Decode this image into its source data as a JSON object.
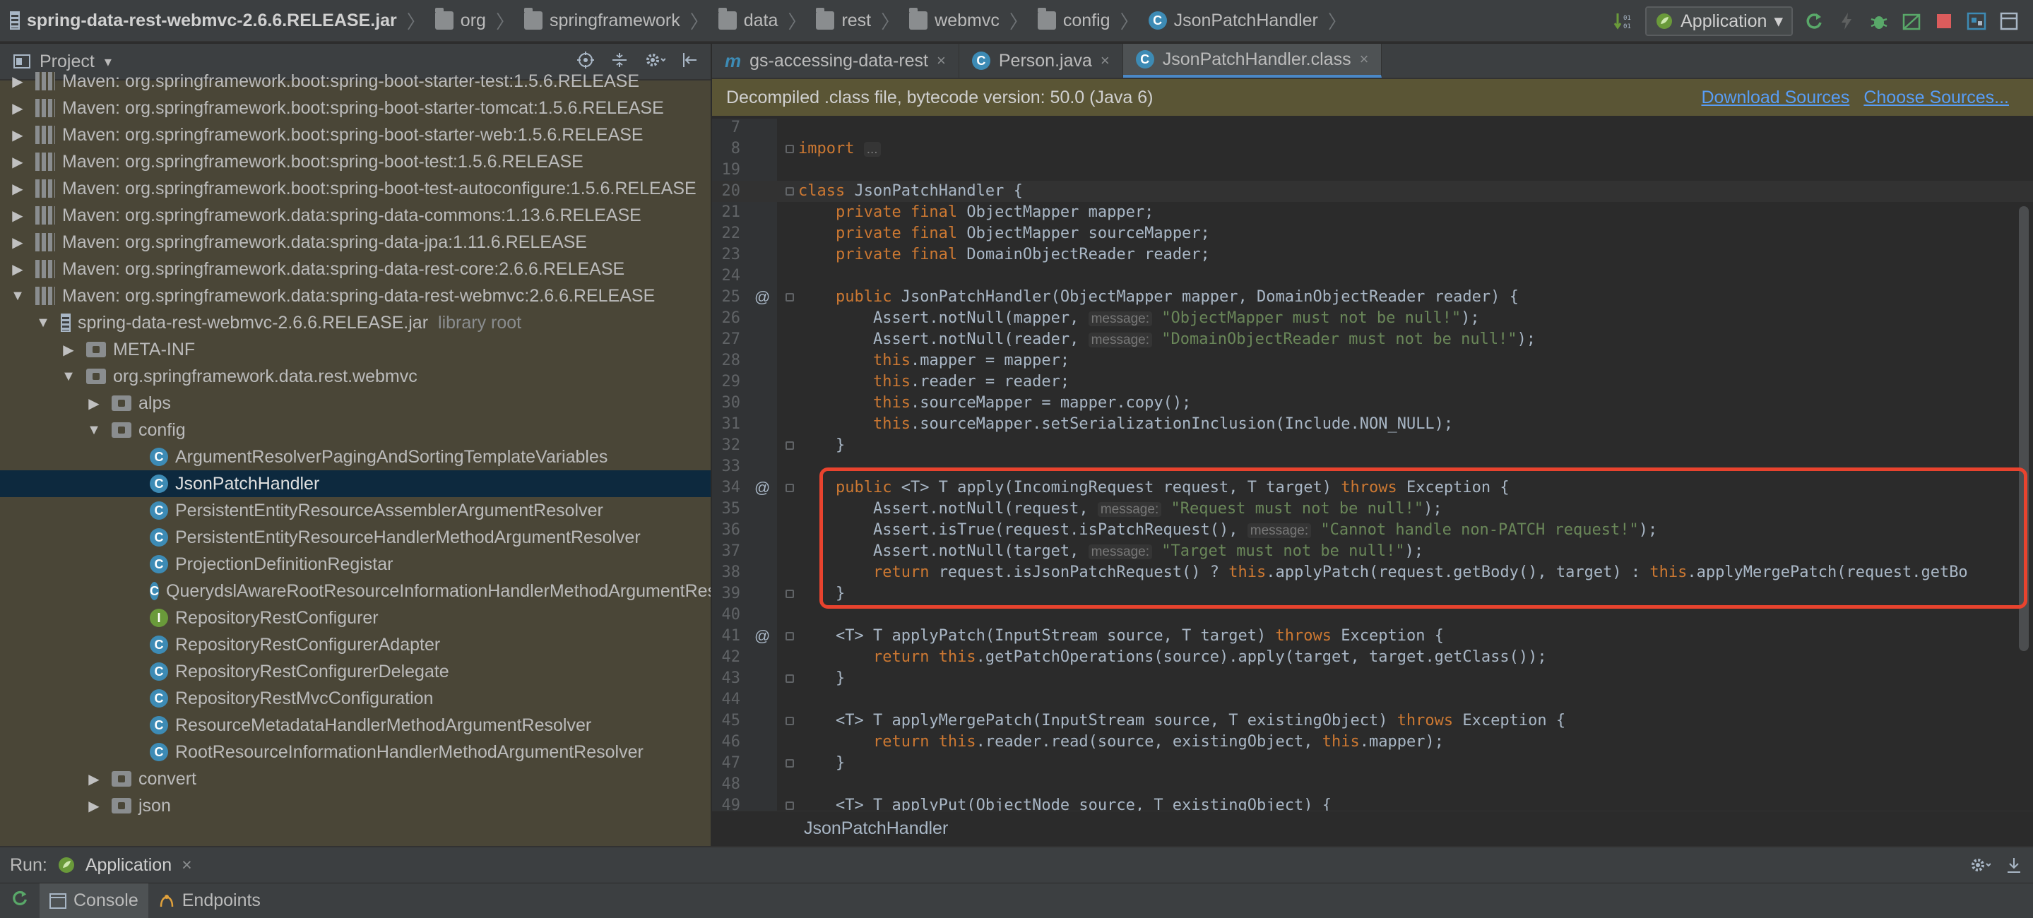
{
  "breadcrumb": [
    {
      "label": "spring-data-rest-webmvc-2.6.6.RELEASE.jar",
      "icon": "jar-icon"
    },
    {
      "label": "org",
      "icon": "folder-icon"
    },
    {
      "label": "springframework",
      "icon": "folder-icon"
    },
    {
      "label": "data",
      "icon": "folder-icon"
    },
    {
      "label": "rest",
      "icon": "folder-icon"
    },
    {
      "label": "webmvc",
      "icon": "folder-icon"
    },
    {
      "label": "config",
      "icon": "folder-icon"
    },
    {
      "label": "JsonPatchHandler",
      "icon": "class-icon"
    }
  ],
  "run_config": {
    "label": "Application"
  },
  "project": {
    "title": "Project",
    "tree": [
      {
        "label": "Maven: org.springframework.boot:spring-boot-starter-test:1.5.6.RELEASE",
        "depth": 0,
        "arrow": "▶",
        "icon": "lib"
      },
      {
        "label": "Maven: org.springframework.boot:spring-boot-starter-tomcat:1.5.6.RELEASE",
        "depth": 0,
        "arrow": "▶",
        "icon": "lib"
      },
      {
        "label": "Maven: org.springframework.boot:spring-boot-starter-web:1.5.6.RELEASE",
        "depth": 0,
        "arrow": "▶",
        "icon": "lib"
      },
      {
        "label": "Maven: org.springframework.boot:spring-boot-test:1.5.6.RELEASE",
        "depth": 0,
        "arrow": "▶",
        "icon": "lib"
      },
      {
        "label": "Maven: org.springframework.boot:spring-boot-test-autoconfigure:1.5.6.RELEASE",
        "depth": 0,
        "arrow": "▶",
        "icon": "lib"
      },
      {
        "label": "Maven: org.springframework.data:spring-data-commons:1.13.6.RELEASE",
        "depth": 0,
        "arrow": "▶",
        "icon": "lib"
      },
      {
        "label": "Maven: org.springframework.data:spring-data-jpa:1.11.6.RELEASE",
        "depth": 0,
        "arrow": "▶",
        "icon": "lib"
      },
      {
        "label": "Maven: org.springframework.data:spring-data-rest-core:2.6.6.RELEASE",
        "depth": 0,
        "arrow": "▶",
        "icon": "lib"
      },
      {
        "label": "Maven: org.springframework.data:spring-data-rest-webmvc:2.6.6.RELEASE",
        "depth": 0,
        "arrow": "▼",
        "icon": "lib"
      },
      {
        "label": "spring-data-rest-webmvc-2.6.6.RELEASE.jar",
        "depth": 1,
        "arrow": "▼",
        "icon": "jar",
        "suffix": "library root"
      },
      {
        "label": "META-INF",
        "depth": 2,
        "arrow": "▶",
        "icon": "pkg"
      },
      {
        "label": "org.springframework.data.rest.webmvc",
        "depth": 2,
        "arrow": "▼",
        "icon": "pkg"
      },
      {
        "label": "alps",
        "depth": 3,
        "arrow": "▶",
        "icon": "pkg"
      },
      {
        "label": "config",
        "depth": 3,
        "arrow": "▼",
        "icon": "pkg"
      },
      {
        "label": "ArgumentResolverPagingAndSortingTemplateVariables",
        "depth": 4,
        "arrow": "",
        "icon": "class"
      },
      {
        "label": "JsonPatchHandler",
        "depth": 4,
        "arrow": "",
        "icon": "class",
        "selected": true
      },
      {
        "label": "PersistentEntityResourceAssemblerArgumentResolver",
        "depth": 4,
        "arrow": "",
        "icon": "class"
      },
      {
        "label": "PersistentEntityResourceHandlerMethodArgumentResolver",
        "depth": 4,
        "arrow": "",
        "icon": "class"
      },
      {
        "label": "ProjectionDefinitionRegistar",
        "depth": 4,
        "arrow": "",
        "icon": "class"
      },
      {
        "label": "QuerydslAwareRootResourceInformationHandlerMethodArgumentResolver",
        "depth": 4,
        "arrow": "",
        "icon": "class"
      },
      {
        "label": "RepositoryRestConfigurer",
        "depth": 4,
        "arrow": "",
        "icon": "iface"
      },
      {
        "label": "RepositoryRestConfigurerAdapter",
        "depth": 4,
        "arrow": "",
        "icon": "class"
      },
      {
        "label": "RepositoryRestConfigurerDelegate",
        "depth": 4,
        "arrow": "",
        "icon": "class"
      },
      {
        "label": "RepositoryRestMvcConfiguration",
        "depth": 4,
        "arrow": "",
        "icon": "class"
      },
      {
        "label": "ResourceMetadataHandlerMethodArgumentResolver",
        "depth": 4,
        "arrow": "",
        "icon": "class"
      },
      {
        "label": "RootResourceInformationHandlerMethodArgumentResolver",
        "depth": 4,
        "arrow": "",
        "icon": "class"
      },
      {
        "label": "convert",
        "depth": 3,
        "arrow": "▶",
        "icon": "pkg"
      },
      {
        "label": "json",
        "depth": 3,
        "arrow": "▶",
        "icon": "pkg"
      }
    ]
  },
  "editor": {
    "tabs": [
      {
        "label": "gs-accessing-data-rest",
        "icon": "maven-icon",
        "active": false
      },
      {
        "label": "Person.java",
        "icon": "class-icon",
        "active": false
      },
      {
        "label": "JsonPatchHandler.class",
        "icon": "class-icon",
        "active": true
      }
    ],
    "banner": "Decompiled .class file, bytecode version: 50.0 (Java 6)",
    "download_sources": "Download Sources",
    "choose_sources": "Choose Sources...",
    "footer_crumb": "JsonPatchHandler",
    "lines": [
      {
        "n": "7",
        "segs": []
      },
      {
        "n": "8",
        "segs": [
          {
            "t": "import ",
            "c": "k"
          },
          {
            "t": "...",
            "c": "hint"
          }
        ]
      },
      {
        "n": "19",
        "segs": []
      },
      {
        "n": "20",
        "segs": [
          {
            "t": "class ",
            "c": "k"
          },
          {
            "t": "JsonPatchHandler {"
          }
        ],
        "current": true
      },
      {
        "n": "21",
        "segs": [
          {
            "t": "    "
          },
          {
            "t": "private final ",
            "c": "k"
          },
          {
            "t": "ObjectMapper mapper;"
          }
        ]
      },
      {
        "n": "22",
        "segs": [
          {
            "t": "    "
          },
          {
            "t": "private final ",
            "c": "k"
          },
          {
            "t": "ObjectMapper sourceMapper;"
          }
        ]
      },
      {
        "n": "23",
        "segs": [
          {
            "t": "    "
          },
          {
            "t": "private final ",
            "c": "k"
          },
          {
            "t": "DomainObjectReader reader;"
          }
        ]
      },
      {
        "n": "24",
        "segs": []
      },
      {
        "n": "25",
        "mark": "@",
        "segs": [
          {
            "t": "    "
          },
          {
            "t": "public ",
            "c": "k"
          },
          {
            "t": "JsonPatchHandler(ObjectMapper mapper, DomainObjectReader reader) {"
          }
        ]
      },
      {
        "n": "26",
        "segs": [
          {
            "t": "        Assert.notNull(mapper, "
          },
          {
            "t": "message:",
            "c": "hint"
          },
          {
            "t": " "
          },
          {
            "t": "\"ObjectMapper must not be null!\"",
            "c": "s"
          },
          {
            "t": ");"
          }
        ]
      },
      {
        "n": "27",
        "segs": [
          {
            "t": "        Assert.notNull(reader, "
          },
          {
            "t": "message:",
            "c": "hint"
          },
          {
            "t": " "
          },
          {
            "t": "\"DomainObjectReader must not be null!\"",
            "c": "s"
          },
          {
            "t": ");"
          }
        ]
      },
      {
        "n": "28",
        "segs": [
          {
            "t": "        "
          },
          {
            "t": "this",
            "c": "k"
          },
          {
            "t": ".mapper = mapper;"
          }
        ]
      },
      {
        "n": "29",
        "segs": [
          {
            "t": "        "
          },
          {
            "t": "this",
            "c": "k"
          },
          {
            "t": ".reader = reader;"
          }
        ]
      },
      {
        "n": "30",
        "segs": [
          {
            "t": "        "
          },
          {
            "t": "this",
            "c": "k"
          },
          {
            "t": ".sourceMapper = mapper.copy();"
          }
        ]
      },
      {
        "n": "31",
        "segs": [
          {
            "t": "        "
          },
          {
            "t": "this",
            "c": "k"
          },
          {
            "t": ".sourceMapper.setSerializationInclusion(Include.NON_NULL);"
          }
        ]
      },
      {
        "n": "32",
        "segs": [
          {
            "t": "    }"
          }
        ]
      },
      {
        "n": "33",
        "segs": []
      },
      {
        "n": "34",
        "mark": "@",
        "segs": [
          {
            "t": "    "
          },
          {
            "t": "public ",
            "c": "k"
          },
          {
            "t": "<T> T apply(IncomingRequest request, T target) "
          },
          {
            "t": "throws ",
            "c": "k"
          },
          {
            "t": "Exception {"
          }
        ]
      },
      {
        "n": "35",
        "segs": [
          {
            "t": "        Assert.notNull(request, "
          },
          {
            "t": "message:",
            "c": "hint"
          },
          {
            "t": " "
          },
          {
            "t": "\"Request must not be null!\"",
            "c": "s"
          },
          {
            "t": ");"
          }
        ]
      },
      {
        "n": "36",
        "segs": [
          {
            "t": "        Assert.isTrue(request.isPatchRequest(), "
          },
          {
            "t": "message:",
            "c": "hint"
          },
          {
            "t": " "
          },
          {
            "t": "\"Cannot handle non-PATCH request!\"",
            "c": "s"
          },
          {
            "t": ");"
          }
        ]
      },
      {
        "n": "37",
        "segs": [
          {
            "t": "        Assert.notNull(target, "
          },
          {
            "t": "message:",
            "c": "hint"
          },
          {
            "t": " "
          },
          {
            "t": "\"Target must not be null!\"",
            "c": "s"
          },
          {
            "t": ");"
          }
        ]
      },
      {
        "n": "38",
        "segs": [
          {
            "t": "        "
          },
          {
            "t": "return ",
            "c": "k"
          },
          {
            "t": "request.isJsonPatchRequest() ? "
          },
          {
            "t": "this",
            "c": "k"
          },
          {
            "t": ".applyPatch(request.getBody(), target) : "
          },
          {
            "t": "this",
            "c": "k"
          },
          {
            "t": ".applyMergePatch(request.getBo"
          }
        ]
      },
      {
        "n": "39",
        "segs": [
          {
            "t": "    }"
          }
        ]
      },
      {
        "n": "40",
        "segs": []
      },
      {
        "n": "41",
        "mark": "@",
        "segs": [
          {
            "t": "    <T> T applyPatch(InputStream source, T target) "
          },
          {
            "t": "throws ",
            "c": "k"
          },
          {
            "t": "Exception {"
          }
        ]
      },
      {
        "n": "42",
        "segs": [
          {
            "t": "        "
          },
          {
            "t": "return ",
            "c": "k"
          },
          {
            "t": "this",
            "c": "k"
          },
          {
            "t": ".getPatchOperations(source).apply(target, target.getClass());"
          }
        ]
      },
      {
        "n": "43",
        "segs": [
          {
            "t": "    }"
          }
        ]
      },
      {
        "n": "44",
        "segs": []
      },
      {
        "n": "45",
        "segs": [
          {
            "t": "    <T> T applyMergePatch(InputStream source, T existingObject) "
          },
          {
            "t": "throws ",
            "c": "k"
          },
          {
            "t": "Exception {"
          }
        ]
      },
      {
        "n": "46",
        "segs": [
          {
            "t": "        "
          },
          {
            "t": "return ",
            "c": "k"
          },
          {
            "t": "this",
            "c": "k"
          },
          {
            "t": ".reader.read(source, existingObject, "
          },
          {
            "t": "this",
            "c": "k"
          },
          {
            "t": ".mapper);"
          }
        ]
      },
      {
        "n": "47",
        "segs": [
          {
            "t": "    }"
          }
        ]
      },
      {
        "n": "48",
        "segs": []
      },
      {
        "n": "49",
        "segs": [
          {
            "t": "    <T> T applyPut(ObjectNode source, T existingObject) {"
          }
        ]
      }
    ]
  },
  "run_panel": {
    "label": "Run:",
    "tab": "Application"
  },
  "bottom_tabs": [
    {
      "label": "Console",
      "active": true
    },
    {
      "label": "Endpoints",
      "active": false
    }
  ],
  "colors": {
    "highlight_box": "#e8432e",
    "selection": "#0d293e",
    "link": "#589df6"
  }
}
